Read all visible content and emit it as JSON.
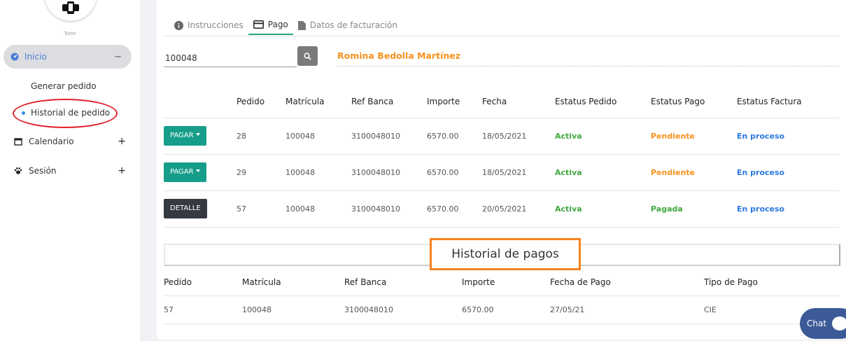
{
  "sidebar": {
    "role": "Tutor",
    "inicio": {
      "label": "Inicio",
      "toggle": "−"
    },
    "sub": {
      "generar": "Generar pedido",
      "historial": "Historial de pedido"
    },
    "calendario": {
      "label": "Calendario",
      "toggle": "+"
    },
    "sesion": {
      "label": "Sesión",
      "toggle": "+"
    }
  },
  "tabs": [
    {
      "label": "Instrucciones",
      "icon": "info-icon"
    },
    {
      "label": "Pago",
      "icon": "credit-card-icon"
    },
    {
      "label": "Datos de facturación",
      "icon": "document-icon"
    }
  ],
  "search": {
    "value": "100048",
    "student_name": "Romina Bedolla Martínez"
  },
  "orders": {
    "headers": [
      "",
      "Pedido",
      "Matrícula",
      "Ref Banca",
      "Importe",
      "Fecha",
      "Estatus Pedido",
      "Estatus Pago",
      "Estatus Factura"
    ],
    "rows": [
      {
        "action": "PAGAR",
        "pedido": "28",
        "matricula": "100048",
        "ref": "3100048010",
        "importe": "6570.00",
        "fecha": "18/05/2021",
        "estatus_pedido": "Activa",
        "estatus_pago": "Pendiente",
        "estatus_factura": "En proceso"
      },
      {
        "action": "PAGAR",
        "pedido": "29",
        "matricula": "100048",
        "ref": "3100048010",
        "importe": "6570.00",
        "fecha": "18/05/2021",
        "estatus_pedido": "Activa",
        "estatus_pago": "Pendiente",
        "estatus_factura": "En proceso"
      },
      {
        "action": "DETALLE",
        "pedido": "57",
        "matricula": "100048",
        "ref": "3100048010",
        "importe": "6570.00",
        "fecha": "20/05/2021",
        "estatus_pedido": "Activa",
        "estatus_pago": "Pagada",
        "estatus_factura": "En proceso"
      }
    ]
  },
  "history": {
    "title": "Historial de pagos",
    "headers": [
      "Pedido",
      "Matrícula",
      "Ref Banca",
      "Importe",
      "Fecha de Pago",
      "Tipo de Pago"
    ],
    "rows": [
      {
        "pedido": "57",
        "matricula": "100048",
        "ref": "3100048010",
        "importe": "6570.00",
        "fecha": "27/05/21",
        "tipo": "CIE"
      }
    ]
  },
  "chat": {
    "label": "Chat"
  },
  "colors": {
    "accent_green": "#179e8a",
    "status_active": "#40a841",
    "status_pending": "#f6921e",
    "status_invoice": "#2d78e0",
    "highlight_orange": "#f6821e",
    "annotation_red": "#e2202a"
  }
}
